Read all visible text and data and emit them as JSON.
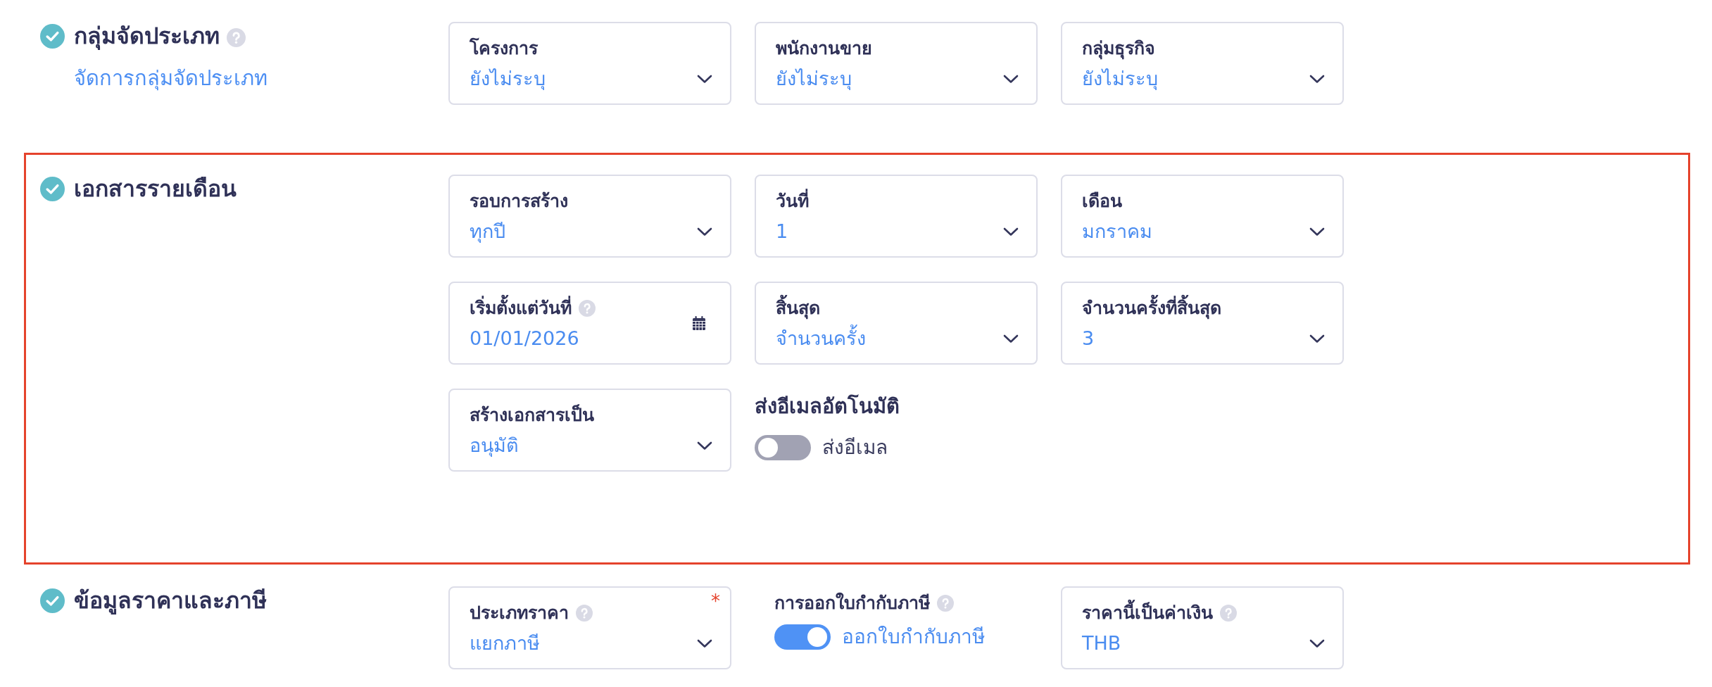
{
  "sections": [
    {
      "title": "กลุ่มจัดประเภท",
      "help": true,
      "complete": true,
      "highlighted": false,
      "link": "จัดการกลุ่มจัดประเภท",
      "fields": [
        {
          "kind": "select",
          "label": "โครงการ",
          "help": false,
          "value": "ยังไม่ระบุ"
        },
        {
          "kind": "select",
          "label": "พนักงานขาย",
          "help": false,
          "value": "ยังไม่ระบุ"
        },
        {
          "kind": "select",
          "label": "กลุ่มธุรกิจ",
          "help": false,
          "value": "ยังไม่ระบุ"
        }
      ]
    },
    {
      "title": "เอกสารรายเดือน",
      "help": false,
      "complete": true,
      "highlighted": true,
      "fields": [
        {
          "kind": "select",
          "label": "รอบการสร้าง",
          "help": false,
          "value": "ทุกปี"
        },
        {
          "kind": "select",
          "label": "วันที่",
          "help": false,
          "value": "1"
        },
        {
          "kind": "select",
          "label": "เดือน",
          "help": false,
          "value": "มกราคม"
        },
        {
          "kind": "date",
          "label": "เริ่มตั้งแต่วันที่",
          "help": true,
          "value": "01/01/2026"
        },
        {
          "kind": "select",
          "label": "สิ้นสุด",
          "help": false,
          "value": "จำนวนครั้ง"
        },
        {
          "kind": "select",
          "label": "จำนวนครั้งที่สิ้นสุด",
          "help": false,
          "value": "3"
        },
        {
          "kind": "select",
          "label": "สร้างเอกสารเป็น",
          "help": false,
          "value": "อนุมัติ"
        },
        {
          "kind": "switch",
          "label": "ส่งอีเมลอัตโนมัติ",
          "help": false,
          "on": false,
          "text": "ส่งอีเมล"
        }
      ]
    },
    {
      "title": "ข้อมูลราคาและภาษี",
      "help": false,
      "complete": true,
      "highlighted": false,
      "fields": [
        {
          "kind": "select",
          "label": "ประเภทราคา",
          "help": true,
          "required_mark": "*",
          "value": "แยกภาษี"
        },
        {
          "kind": "toggle",
          "label": "การออกใบกำกับภาษี",
          "help": true,
          "on": true,
          "text": "ออกใบกำกับภาษี"
        },
        {
          "kind": "select",
          "label": "ราคานี้เป็นค่าเงิน",
          "help": true,
          "value": "THB"
        }
      ]
    }
  ]
}
